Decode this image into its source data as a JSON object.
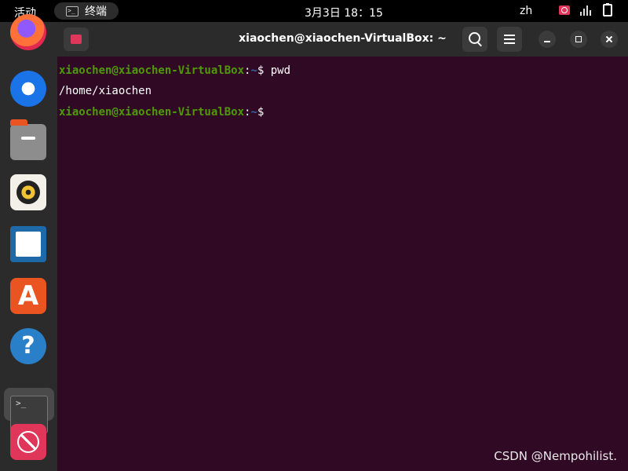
{
  "topbar": {
    "activities": "活动",
    "app_label": "终端",
    "clock": "3月3日  18：15",
    "language": "zh"
  },
  "dock": {
    "apps": [
      "firefox-icon",
      "thunderbird-icon",
      "files-icon",
      "rhythmbox-icon",
      "writer-icon",
      "software-icon",
      "help-icon",
      "terminal-icon",
      "blocked-icon"
    ]
  },
  "terminal": {
    "title": "xiaochen@xiaochen-VirtualBox: ~",
    "lines": [
      {
        "user": "xiaochen@xiaochen-VirtualBox",
        "sep": ":",
        "path": "~",
        "prompt": "$ ",
        "cmd": "pwd"
      },
      {
        "output": "/home/xiaochen"
      },
      {
        "user": "xiaochen@xiaochen-VirtualBox",
        "sep": ":",
        "path": "~",
        "prompt": "$ ",
        "cmd": ""
      }
    ]
  },
  "watermark": "CSDN @Nempohilist.",
  "colors": {
    "terminal_bg": "#300a24",
    "user_green": "#4e9a06",
    "path_blue": "#3465a4",
    "accent_red": "#e0365a",
    "ubuntu_orange": "#e95420"
  }
}
